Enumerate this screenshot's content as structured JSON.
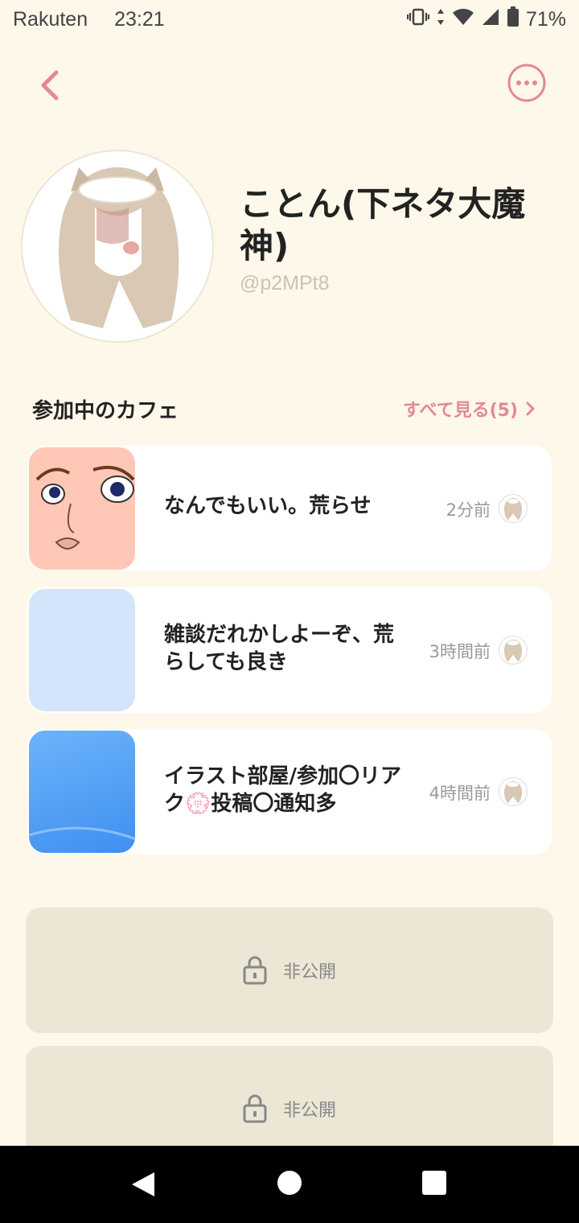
{
  "status_bar": {
    "carrier": "Rakuten",
    "time": "23:21",
    "battery": "71%"
  },
  "profile": {
    "name": "ことん(下ネタ大魔神)",
    "user_id": "@p2MPt8"
  },
  "cafes_section": {
    "title": "参加中のカフェ",
    "see_all": "すべて見る(5)"
  },
  "cafes": [
    {
      "title": "なんでもいい。荒らせ",
      "time": "2分前",
      "thumb_color": "#ffc7b6"
    },
    {
      "title": "雑談だれかしよーぞ、荒らしても良き",
      "time": "3時間前",
      "thumb_color": "#d4e4fb"
    },
    {
      "title": "イラスト部屋/参加〇リアク💮投稿〇通知多",
      "time": "4時間前",
      "thumb_color": "#5aa5f5"
    }
  ],
  "private_cards": [
    {
      "label": "非公開"
    },
    {
      "label": "非公開"
    }
  ],
  "colors": {
    "background": "#fdf8ea",
    "accent": "#e48895",
    "private_bg": "#ece6d5"
  },
  "icons": {
    "back": "chevron-left-icon",
    "more": "more-horizontal-icon",
    "lock": "lock-icon",
    "see_all_arrow": "chevron-right-icon"
  }
}
